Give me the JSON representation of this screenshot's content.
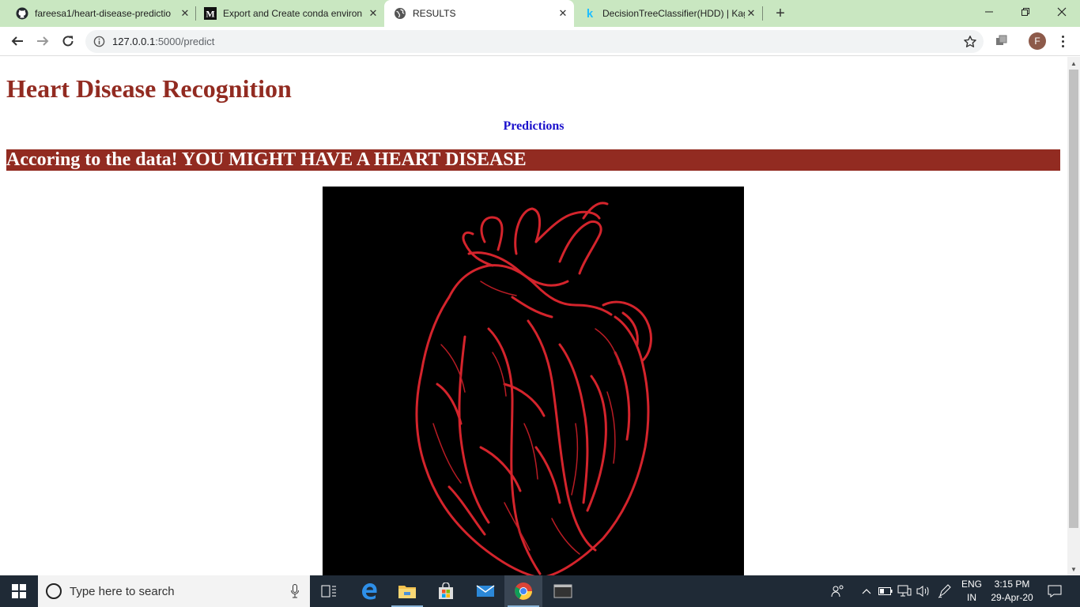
{
  "browser": {
    "tabs": [
      {
        "title": "fareesa1/heart-disease-predictio",
        "icon": "github-icon"
      },
      {
        "title": "Export and Create conda environ",
        "icon": "medium-icon"
      },
      {
        "title": "RESULTS",
        "icon": "globe-icon",
        "active": true
      },
      {
        "title": "DecisionTreeClassifier(HDD) | Kag",
        "icon": "kaggle-icon"
      }
    ],
    "close_glyph": "✕",
    "new_tab_glyph": "+",
    "url_host": "127.0.0.1",
    "url_rest": ":5000/predict",
    "profile_initial": "F"
  },
  "page": {
    "heading": "Heart Disease Recognition",
    "subheading": "Predictions",
    "result_banner": "Accoring to the data! YOU MIGHT HAVE A HEART DISEASE",
    "image_alt": "red sketch of a human heart on black background"
  },
  "taskbar": {
    "search_placeholder": "Type here to search",
    "lang_top": "ENG",
    "lang_bottom": "IN",
    "time": "3:15 PM",
    "date": "29-Apr-20"
  },
  "colors": {
    "heading": "#922b21",
    "subheading": "#1a10cc",
    "banner_bg": "#922b21",
    "tabstrip": "#c9e7c1",
    "taskbar": "#1f2a36"
  }
}
